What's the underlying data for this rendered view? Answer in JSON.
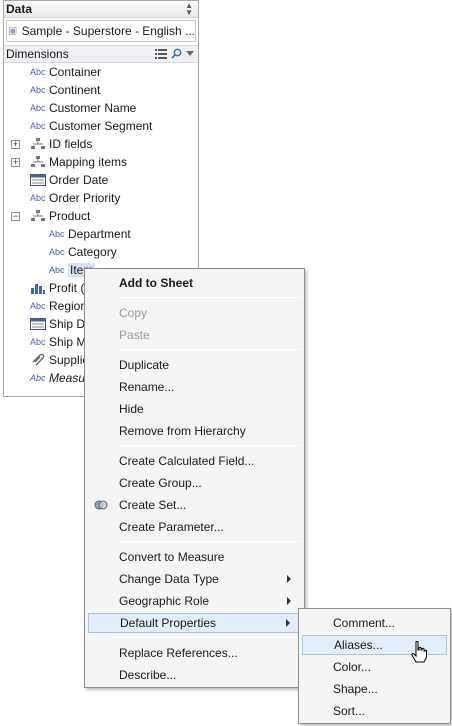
{
  "pane": {
    "title": "Data"
  },
  "datasource": {
    "name": "Sample - Superstore - English ..."
  },
  "dimensions": {
    "label": "Dimensions"
  },
  "fields": [
    {
      "label": "Container"
    },
    {
      "label": "Continent"
    },
    {
      "label": "Customer Name"
    },
    {
      "label": "Customer Segment"
    },
    {
      "label": "ID fields"
    },
    {
      "label": "Mapping items"
    },
    {
      "label": "Order Date"
    },
    {
      "label": "Order Priority"
    },
    {
      "label": "Product"
    },
    {
      "label": "Department"
    },
    {
      "label": "Category"
    },
    {
      "label": "Item"
    },
    {
      "label": "Profit ("
    },
    {
      "label": "Region"
    },
    {
      "label": "Ship D"
    },
    {
      "label": "Ship M"
    },
    {
      "label": "Supplie"
    },
    {
      "label": "Measure"
    }
  ],
  "abc_text": "Abc",
  "context_menu": {
    "add_to_sheet": "Add to Sheet",
    "copy": "Copy",
    "paste": "Paste",
    "duplicate": "Duplicate",
    "rename": "Rename...",
    "hide": "Hide",
    "remove_from_hierarchy": "Remove from Hierarchy",
    "create_calculated_field": "Create Calculated Field...",
    "create_group": "Create Group...",
    "create_set": "Create Set...",
    "create_parameter": "Create Parameter...",
    "convert_to_measure": "Convert to Measure",
    "change_data_type": "Change Data Type",
    "geographic_role": "Geographic Role",
    "default_properties": "Default Properties",
    "replace_references": "Replace References...",
    "describe": "Describe..."
  },
  "submenu": {
    "comment": "Comment...",
    "aliases": "Aliases...",
    "color": "Color...",
    "shape": "Shape...",
    "sort": "Sort..."
  },
  "colors": {
    "abc_blue": "#3b64b5",
    "highlight": "#e3edf9",
    "border": "#8e8e8e"
  }
}
